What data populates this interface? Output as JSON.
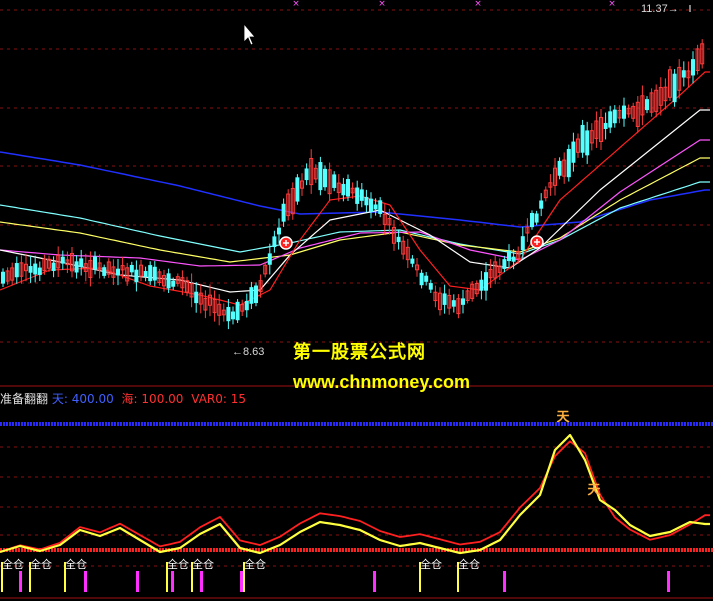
{
  "watermark": {
    "site_name": "第一股票公式网",
    "site_url": "www.chnmoney.com"
  },
  "price_labels": {
    "high": "11.37",
    "low": "8.63"
  },
  "indicator_header": {
    "name": "准备翻翻",
    "tian_label": "天:",
    "tian_value": "400.00",
    "hai_label": "海:",
    "hai_value": "100.00",
    "var_label": "VAR0:",
    "var_value": "15"
  },
  "signal_text": "全仓",
  "tian_marker_text": "天",
  "colors": {
    "background": "#000000",
    "up_candle": "#ff3b3b",
    "down_candle": "#54ffff",
    "ma_white": "#ffffff",
    "ma_yellow": "#ffff66",
    "ma_magenta": "#ff55ff",
    "ma_cyan": "#80ffff",
    "ma_blue": "#2030ff",
    "ma_red": "#ff2020",
    "tian_line": "#2a2aff",
    "hai_line": "#ff2020",
    "osc_yellow": "#ffff40",
    "osc_red": "#ff2020",
    "signal_yellow": "#ffff40",
    "signal_magenta": "#ff30ff"
  },
  "chart_data": [
    {
      "type": "candlestick",
      "low_point": 8.63,
      "high_point": 11.37,
      "moving_averages": [
        "white",
        "yellow",
        "magenta",
        "cyan",
        "blue",
        "red"
      ],
      "grid": true
    },
    {
      "type": "line",
      "series": [
        {
          "name": "天",
          "value": 400.0
        },
        {
          "name": "海",
          "value": 100.0
        },
        {
          "name": "VAR0",
          "value": 15
        }
      ],
      "signals_full_position": 7,
      "grid": true
    }
  ]
}
